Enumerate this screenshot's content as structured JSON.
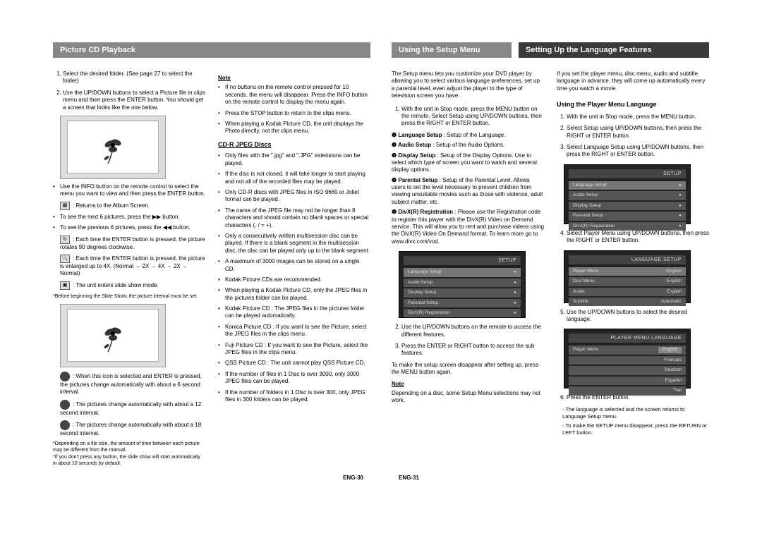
{
  "left": {
    "header1": "Picture CD Playback",
    "steps": {
      "s1": "Select the desired folder. (See page 27 to select the folder)",
      "s2": "Use the UP/DOWN buttons to select a Picture file in clips menu and then press the ENTER button. You should get a screen that looks like the one below."
    },
    "info": "Use the INFO button on the remote control to select the menu you want to view and then press the ENTER button.",
    "icons": {
      "i1": ": Returns to the Album Screen.",
      "i2": "To see the next 6 pictures, press the ▶▶ button.",
      "i3": "To see the previous 6 pictures, press the ◀◀ button.",
      "i4": ": Each time the ENTER button is pressed, the picture rotates 90 degrees clockwise.",
      "i5": ": Each time the ENTER button is pressed, the picture is enlarged up to 4X. (Normal → 2X → 4X → 2X → Normal)",
      "i6": ": The unit enters slide show mode."
    },
    "before_slide": "*Before beginning the Slide Show, the picture interval must be set.",
    "slide": {
      "a": ": When this icon is selected and ENTER is pressed, the pictures change automatically with about a 6 second interval.",
      "b": ": The pictures change automatically with about a 12 second interval.",
      "c": ": The pictures change automatically with about a 18 second interval."
    },
    "foot1": "*Depending on a file size, the amount of time between each picture may be different from the manual.",
    "foot2": "*If you don't press any button, the slide show will start automatically in about 10 seconds by default.",
    "col2": {
      "note_label": "Note",
      "n1": "If no buttons on the remote control pressed for 10 seconds, the menu will disappear. Press the INFO button on the remote control to display the menu again.",
      "n2": "Press the STOP button to return to the clips menu.",
      "n3": "When playing a Kodak Picture CD, the unit displays the Photo directly, not the clips menu.",
      "cdr_heading": "CD-R JPEG Discs",
      "c1": "Only files with the \".jpg\" and \".JPG\" extensions can be played.",
      "c2": "If the disc is not closed, it will take longer to start playing and not all of the recorded files may be played.",
      "c3": "Only CD-R discs with JPEG files in ISO 9660 or Joliet format can be played.",
      "c4": "The name of the JPEG file may not be longer than 8 characters and should contain no blank spaces or special characters (. / = +).",
      "c5": "Only a consecutively written multisession disc can be played. If there is a blank segment in the multisession disc, the disc can be played only up to the blank segment.",
      "c6": "A maximum of 3000 images can be stored on a single CD.",
      "c7": "Kodak Picture CDs are recommended.",
      "c8": "When playing a Kodak Picture CD, only the JPEG files in the pictures folder can be played.",
      "c9": "Kodak Picture CD : The JPEG files in the pictures folder can be played automatically.",
      "c10": "Konica Picture CD : If you want to see the Picture, select the JPEG files in the clips menu.",
      "c11": "Fuji Picture CD : If you want to see the Picture, select the JPEG files in the clips menu.",
      "c12": "QSS Picture CD : The unit cannot play QSS Picture CD.",
      "c13": "If the number of files in 1 Disc is over 3000, only 3000 JPEG files can be played.",
      "c14": "If the number of folders in 1 Disc is over 300, only JPEG files in 300 folders can be played."
    },
    "page_num": "ENG-30"
  },
  "right": {
    "header1": "Using the Setup Menu",
    "header2": "Setting Up the Language Features",
    "intro": "The Setup menu lets you customize your DVD player by allowing you to select various language preferences, set up a parental level, even adjust the player to the type of television screen you have.",
    "s1": "With the unit in Stop mode, press the MENU button on the remote. Select Setup using UP/DOWN buttons, then press the RIGHT or ENTER button.",
    "opt1_label": "❶ Language Setup",
    "opt1": " : Setup of the Language.",
    "opt2_label": "❷ Audio Setup",
    "opt2": " : Setup of the Audio Options.",
    "opt3_label": "❸ Display Setup",
    "opt3": " : Setup of the Display Options. Use to select which type of screen you want to watch and several display options.",
    "opt4_label": "❹ Parental Setup",
    "opt4": " : Setup of the Parental Level. Allows users to set the level necessary to prevent children from viewing unsuitable movies such as those with violence, adult subject matter, etc.",
    "opt5_label": "❺ DivX(R) Registration",
    "opt5": " : Please use the Registration code to register this player with the DivX(R) Video on Demand service. This will allow you to rent and purchase videos using the DivX(R) Video On Demand format. To learn more go to www.divx.com/vod.",
    "s2": "Use the UP/DOWN buttons on the remote to access the different features.",
    "s3": "Press the ENTER or RIGHT button to access the sub features.",
    "close": "To make the setup screen disappear after setting up, press the MENU button again.",
    "note_label": "Note",
    "note": "Depending on a disc, some Setup Menu selections may not work.",
    "r2intro": "If you set the player menu, disc menu, audio and subtitle language in advance, they will come up automatically every time you watch a movie.",
    "r2_heading": "Using the Player Menu Language",
    "r2_1": "With the unit in Stop mode, press the MENU button.",
    "r2_2": "Select Setup using UP/DOWN buttons, then press the RIGHT or ENTER button.",
    "r2_3": "Select Language Setup using UP/DOWN buttons, then press the RIGHT or ENTER button.",
    "r2_4": "Select Player Menu using UP/DOWN buttons, then press the RIGHT or ENTER button.",
    "r2_5": "Use the UP/DOWN buttons to select the desired language.",
    "r2_6": "Press the ENTER button.",
    "r2_6a": "- The language is selected and the screen returns to Language Setup menu.",
    "r2_6b": "- To make the SETUP menu disappear, press the RETURN or LEFT button.",
    "page_num": "ENG-31",
    "osd": {
      "setup_title": "SETUP",
      "lang_title": "LANGUAGE SETUP",
      "pml_title": "PLAYER MENU LANGUAGE",
      "r_lang": "Language Setup",
      "r_audio": "Audio Setup",
      "r_display": "Display Setup",
      "r_parental": "Parental Setup :",
      "r_divx": "DivX(R) Registration",
      "pm": "Player Menu",
      "pm_v": ": English",
      "dm": "Disc Menu",
      "dm_v": ": English",
      "au": "Audio",
      "au_v": ": English",
      "su": "Subtitle",
      "su_v": ": Automatic",
      "l_en": "English",
      "l_fr": "Français",
      "l_de": "Deutsch",
      "l_es": "Español",
      "l_th": "Thai"
    }
  }
}
